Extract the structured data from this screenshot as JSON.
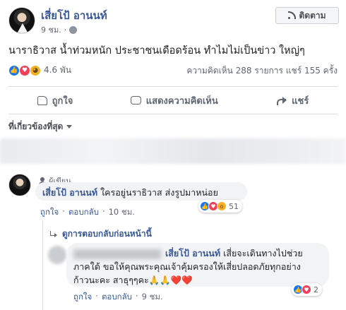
{
  "post": {
    "author": "เสี่ยโป้ อานนท์",
    "time": "9 ชม.",
    "follow_label": "ติดตาม",
    "text": "นาราธิวาส น้ำท่วมหนัก ประชาชนเดือดร้อน ทำไมไม่เป็นข่าว ใหญ่ๆ",
    "reaction_count": "4.6 พัน",
    "stats": "ความคิดเห็น 288 รายการ  แชร์ 155 ครั้ง",
    "reaction_icons": [
      "like-icon",
      "love-icon",
      "sad-icon"
    ]
  },
  "actions": {
    "like": "ถูกใจ",
    "comment": "แสดงความคิดเห็น",
    "share": "แชร์"
  },
  "comments": {
    "sort_label": "ที่เกี่ยวข้องที่สุด",
    "first": {
      "badge": "ผู้เขียน",
      "author": "เสี่ยโป้ อานนท์",
      "text": "ใครอยู่นราธิวาส ส่งรูปมาหน่อย",
      "like": "ถูกใจ",
      "reply": "ตอบกลับ",
      "time": "10 ชม.",
      "reaction_count": "51"
    },
    "previous_replies": "ดูการตอบกลับก่อนหน้านี้",
    "reply": {
      "mention": "เสี่ยโป้ อานนท์",
      "line1_rest": "เสี่ยจะเดินทางไปช่วย",
      "line2": "ภาคใต้ ขอให้คุณพระคุณเจ้าคุ้มครองให้เสี่ยปลอดภัยทุกอย่าง",
      "line3": "ก้าวนะคะ สาธุๆๆคะ",
      "emojis": "🙏🙏❤️❤️",
      "like": "ถูกใจ",
      "reply": "ตอบกลับ",
      "time": "9 ชม.",
      "reaction_count": "2"
    }
  },
  "colors": {
    "link": "#385898",
    "meta": "#606770",
    "bubble": "#f2f3f5",
    "like_blue": "#1877f2",
    "love_red": "#f33e58"
  }
}
